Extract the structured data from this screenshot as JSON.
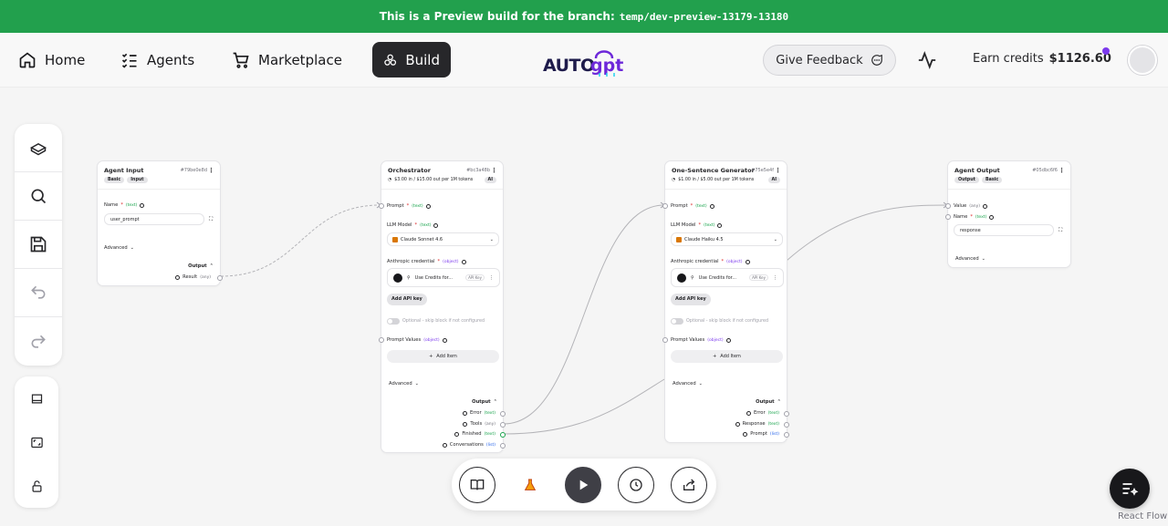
{
  "banner": {
    "text": "This is a Preview build for the branch:",
    "branch": "temp/dev-preview-13179-13180"
  },
  "nav": {
    "items": [
      {
        "label": "Home",
        "icon": "home-icon"
      },
      {
        "label": "Agents",
        "icon": "list-check-icon"
      },
      {
        "label": "Marketplace",
        "icon": "cart-icon"
      },
      {
        "label": "Build",
        "icon": "blocks-icon",
        "active": true
      }
    ],
    "logo": "AUTOgpt",
    "feedback_label": "Give Feedback",
    "credits_label": "Earn credits",
    "credits_value": "$1126.60"
  },
  "left_toolbar": {
    "primary": [
      "blocks-icon",
      "search-icon",
      "save-icon",
      "undo-icon",
      "redo-icon"
    ],
    "secondary": [
      "fit-view-icon",
      "frame-icon",
      "lock-icon"
    ]
  },
  "nodes": {
    "agent_input": {
      "title": "Agent Input",
      "id": "#79be0e8d",
      "chips": [
        "Basic",
        "Input"
      ],
      "field_label": "Name",
      "field_type": "(text)",
      "field_value": "user_prompt",
      "advanced": "Advanced",
      "output_label": "Output",
      "outputs": [
        {
          "label": "Result",
          "type": "(any)"
        }
      ]
    },
    "orchestrator": {
      "title": "Orchestrator",
      "id": "#bc3a48b",
      "cost": "$3.00 in / $15.00 out per 1M tokens",
      "chip": "AI",
      "prompt_label": "Prompt",
      "prompt_type": "(text)",
      "model_label": "LLM Model",
      "model_type": "(text)",
      "model_value": "Claude Sonnet 4.6",
      "cred_label": "Anthropic credential",
      "cred_type": "(object)",
      "cred_value": "Use Credits for...",
      "cred_tag": "API Key",
      "add_key": "Add API key",
      "optional": "Optional - skip block if not configured",
      "pv_label": "Prompt Values",
      "pv_type": "(object)",
      "add_item": "Add Item",
      "advanced": "Advanced",
      "output_label": "Output",
      "outputs": [
        {
          "label": "Error",
          "type": "(text)"
        },
        {
          "label": "Tools",
          "type": "(any)"
        },
        {
          "label": "Finished",
          "type": "(text)"
        },
        {
          "label": "Conversations",
          "type": "(list)"
        }
      ]
    },
    "one_sentence": {
      "title": "One-Sentence Generator",
      "id": "#75e5e4f",
      "cost": "$1.00 in / $5.00 out per 1M tokens",
      "chip": "AI",
      "prompt_label": "Prompt",
      "prompt_type": "(text)",
      "model_label": "LLM Model",
      "model_type": "(text)",
      "model_value": "Claude Haiku 4.5",
      "cred_label": "Anthropic credential",
      "cred_type": "(object)",
      "cred_value": "Use Credits for...",
      "cred_tag": "API Key",
      "add_key": "Add API key",
      "optional": "Optional - skip block if not configured",
      "pv_label": "Prompt Values",
      "pv_type": "(object)",
      "add_item": "Add Item",
      "advanced": "Advanced",
      "output_label": "Output",
      "outputs": [
        {
          "label": "Error",
          "type": "(text)"
        },
        {
          "label": "Response",
          "type": "(text)"
        },
        {
          "label": "Prompt",
          "type": "(list)"
        }
      ]
    },
    "agent_output": {
      "title": "Agent Output",
      "id": "#05dbc6f6",
      "chips": [
        "Output",
        "Basic"
      ],
      "value_label": "Value",
      "value_type": "(any)",
      "name_label": "Name",
      "name_type": "(text)",
      "name_value": "response",
      "advanced": "Advanced"
    }
  },
  "bottom_toolbar": [
    "book-icon",
    "flask-icon",
    "play-icon",
    "history-icon",
    "share-icon"
  ],
  "footer": {
    "react_flow": "React Flow"
  },
  "colors": {
    "banner": "#22a04d",
    "accent_purple": "#7c3aed",
    "type_text": "#16a34a"
  }
}
